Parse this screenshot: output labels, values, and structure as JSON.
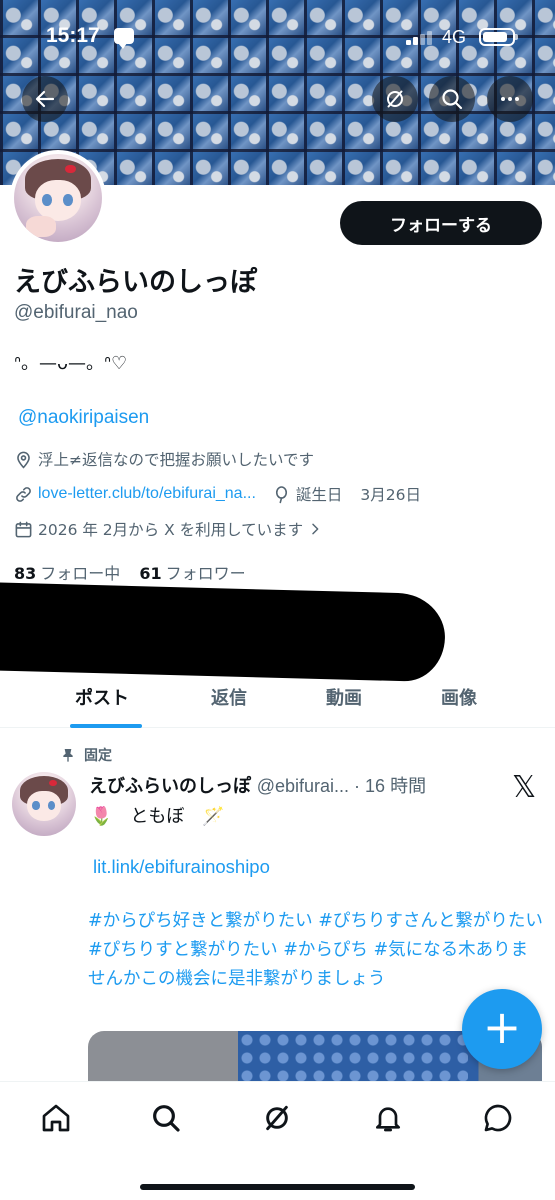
{
  "status_bar": {
    "time": "15:17",
    "network": "4G"
  },
  "profile": {
    "display_name": "えびふらいのしっぽ",
    "handle": "@ebifurai_nao",
    "bio": "ᐢ。—ᴗ—。ᐢ♡",
    "mention": "@naokiripaisen",
    "location": "浮上≠返信なので把握お願いしたいです",
    "website": "love-letter.club/to/ebifurai_na...",
    "birthday_label": "誕生日",
    "birthday": "3月26日",
    "joined": "2026 年 2月から X を利用しています",
    "following_count": "83",
    "following_label": "フォロー中",
    "followers_count": "61",
    "followers_label": "フォロワー",
    "follow_button": "フォローする"
  },
  "tabs": [
    "ポスト",
    "返信",
    "動画",
    "画像"
  ],
  "active_tab": 0,
  "pinned_post": {
    "pinned_label": "固定",
    "author_name": "えびふらいのしっぽ",
    "author_meta": "@ebifurai... · 16 時間",
    "line1": "🌷　ともぼ　🪄",
    "link": "lit.link/ebifurainoshipo",
    "hashtags": "#からぴち好きと繋がりたい #ぴちりすさんと繋がりたい #ぴちりすと繋がりたい #からぴち #気になる木ありませんかこの機会に是非繋がりましょう"
  },
  "icons": {
    "back": "arrow-left-icon",
    "grok": "grok-icon",
    "search": "search-icon",
    "more": "more-icon",
    "x_logo": "𝕏",
    "fab": "+"
  },
  "colors": {
    "accent": "#1d9bf0",
    "text": "#0f1419",
    "muted": "#536471"
  }
}
